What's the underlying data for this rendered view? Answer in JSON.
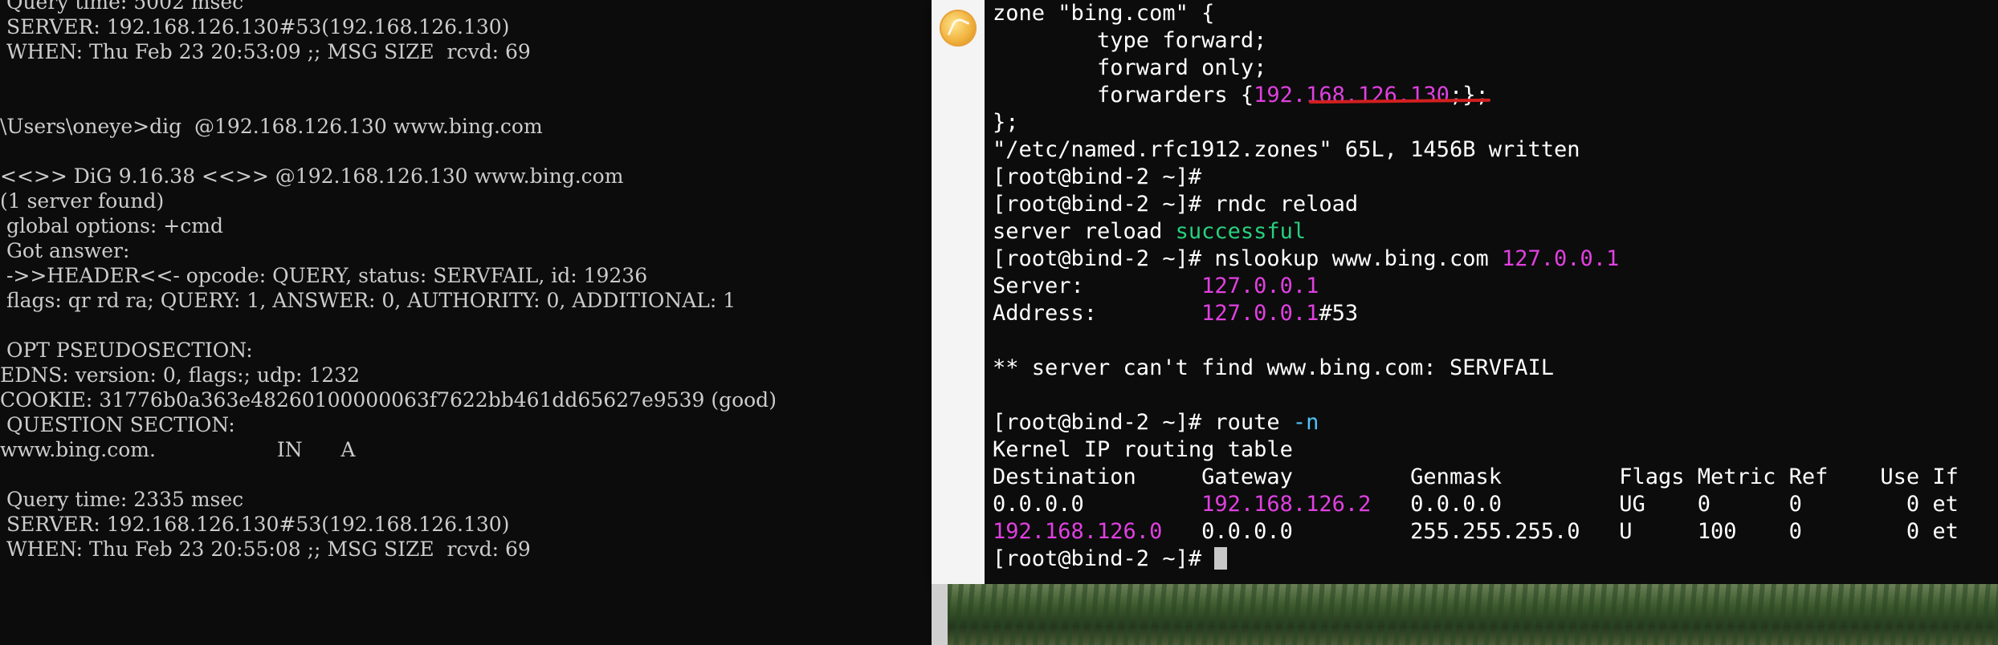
{
  "windows_cmd": {
    "lines": [
      " Query time: 5002 msec",
      " SERVER: 192.168.126.130#53(192.168.126.130)",
      " WHEN: Thu Feb 23 20:53:09 ;; MSG SIZE  rcvd: 69",
      "",
      "",
      "\\Users\\oneye>dig  @192.168.126.130 www.bing.com",
      "",
      "<<>> DiG 9.16.38 <<>> @192.168.126.130 www.bing.com",
      "(1 server found)",
      " global options: +cmd",
      " Got answer:",
      " ->>HEADER<<- opcode: QUERY, status: SERVFAIL, id: 19236",
      " flags: qr rd ra; QUERY: 1, ANSWER: 0, AUTHORITY: 0, ADDITIONAL: 1",
      "",
      " OPT PSEUDOSECTION:",
      "EDNS: version: 0, flags:; udp: 1232",
      "COOKIE: 31776b0a363e48260100000063f7622bb461dd65627e9539 (good)",
      " QUESTION SECTION:",
      "www.bing.com.                   IN      A",
      "",
      " Query time: 2335 msec",
      " SERVER: 192.168.126.130#53(192.168.126.130)",
      " WHEN: Thu Feb 23 20:55:08 ;; MSG SIZE  rcvd: 69"
    ]
  },
  "linux_term": {
    "line1": "zone \"bing.com\" {",
    "line2": "        type forward;",
    "line3": "        forward only;",
    "line4_pre": "        forwarders {",
    "line4_ip": "192.168.126.130",
    "line4_post": ";};",
    "line5": "};",
    "line6": "\"/etc/named.rfc1912.zones\" 65L, 1456B written",
    "line7": "[root@bind-2 ~]#",
    "line8": "[root@bind-2 ~]# rndc reload",
    "line9_pre": "server reload ",
    "line9_ok": "successful",
    "line10_pre": "[root@bind-2 ~]# nslookup www.bing.com ",
    "line10_ip": "127.0.0.1",
    "line11_label": "Server:         ",
    "line11_val": "127.0.0.1",
    "line12_label": "Address:        ",
    "line12_val": "127.0.0.1",
    "line12_port": "#53",
    "line13": "",
    "line14": "** server can't find www.bing.com: SERVFAIL",
    "line15": "",
    "line16_pre": "[root@bind-2 ~]# route ",
    "line16_opt": "-n",
    "line17": "Kernel IP routing table",
    "line18": "Destination     Gateway         Genmask         Flags Metric Ref    Use If",
    "row1_dest": "0.0.0.0         ",
    "row1_gw": "192.168.126.2",
    "row1_rest": "   0.0.0.0         UG    0      0        0 et",
    "row2_dest": "192.168.126.0",
    "row2_rest": "   0.0.0.0         255.255.255.0   U     100    0        0 et",
    "prompt": "[root@bind-2 ~]# "
  },
  "colors": {
    "magenta": "#e040e0",
    "green": "#28d07e",
    "cyan": "#4fc3f7",
    "underline": "#d21f1f"
  }
}
